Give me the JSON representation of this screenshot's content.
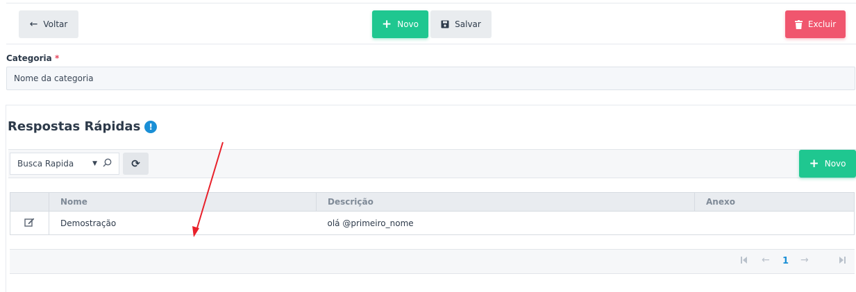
{
  "toolbar": {
    "back_label": "Voltar",
    "new_label": "Novo",
    "save_label": "Salvar",
    "delete_label": "Excluir"
  },
  "form": {
    "category_label": "Categoria",
    "required_mark": "*",
    "category_value": "Nome da categoria"
  },
  "section": {
    "title": "Respostas Rápidas",
    "info_glyph": "!"
  },
  "grid": {
    "search_label": "Busca Rapida",
    "new_label": "Novo",
    "columns": [
      "",
      "Nome",
      "Descrição",
      "Anexo"
    ],
    "rows": [
      {
        "nome": "Demostração",
        "descricao": "olá @primeiro_nome",
        "anexo": ""
      }
    ],
    "pager": {
      "current_page": "1"
    }
  },
  "colors": {
    "accent_green": "#1fc790",
    "danger_red": "#f0566e",
    "info_blue": "#1a8fd6",
    "annotation_red": "#e8202a"
  },
  "icons": [
    "arrow-left-icon",
    "plus-icon",
    "floppy-icon",
    "trash-icon",
    "info-icon",
    "caret-down-icon",
    "search-icon",
    "refresh-icon",
    "edit-icon",
    "page-first-icon",
    "page-prev-icon",
    "page-next-icon",
    "page-last-icon"
  ]
}
